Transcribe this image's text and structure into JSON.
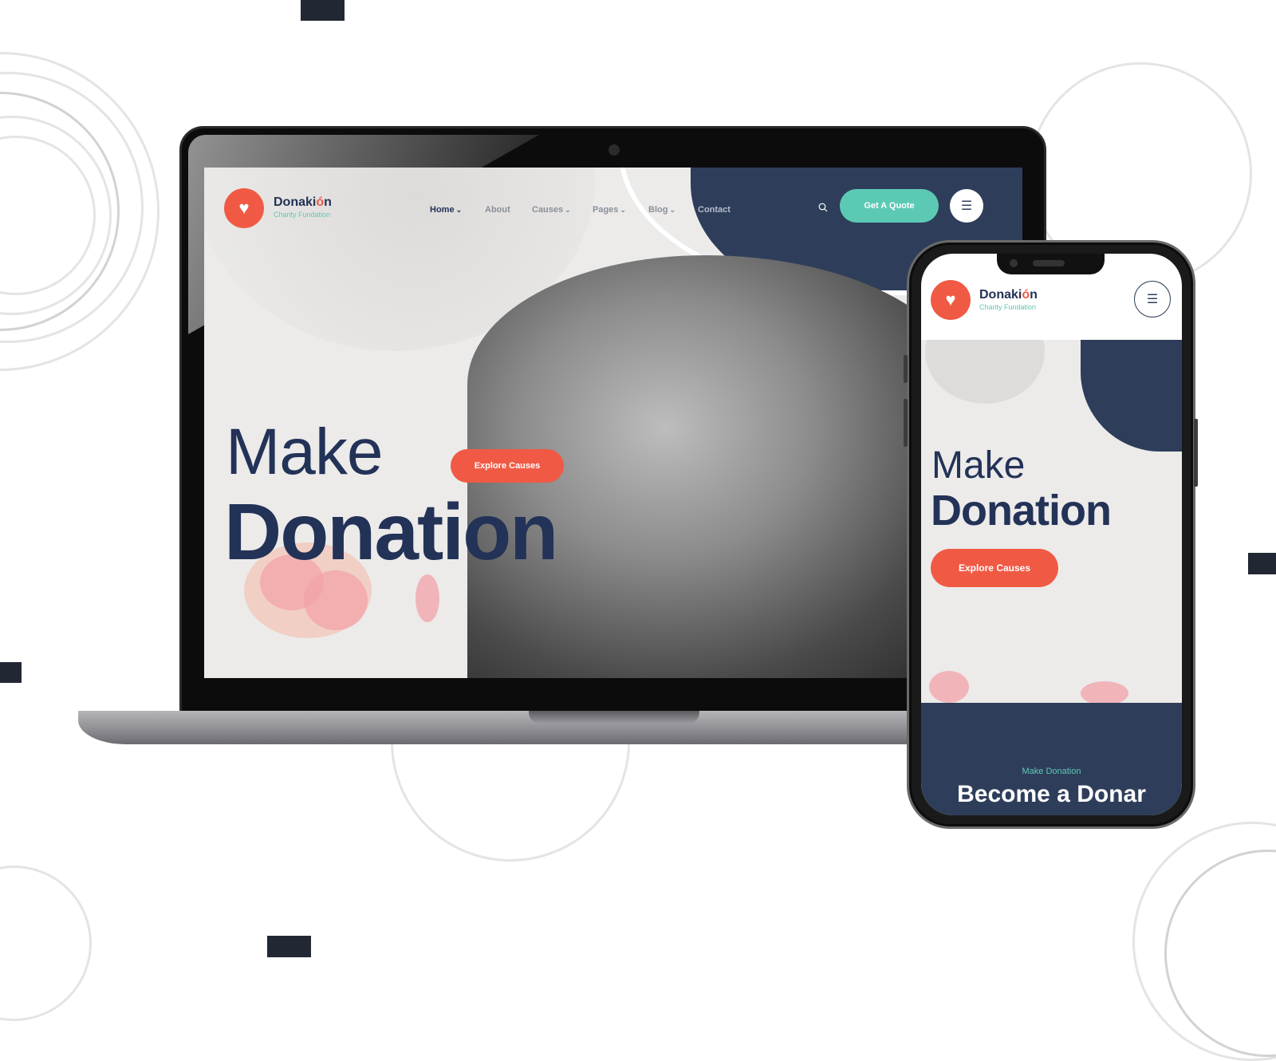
{
  "brand": {
    "name_main": "Donaki",
    "name_accent": "ó",
    "name_end": "n",
    "tagline": "Charity Fundation",
    "logo_icon": "heart-hands-icon"
  },
  "desktop": {
    "nav": [
      {
        "label": "Home",
        "has_dropdown": true,
        "active": true
      },
      {
        "label": "About",
        "has_dropdown": false
      },
      {
        "label": "Causes",
        "has_dropdown": true
      },
      {
        "label": "Pages",
        "has_dropdown": true
      },
      {
        "label": "Blog",
        "has_dropdown": true
      },
      {
        "label": "Contact",
        "has_dropdown": false
      }
    ],
    "search_icon": "search-icon",
    "quote_button": "Get A Quote",
    "menu_icon": "hamburger-icon",
    "hero_line1": "Make",
    "hero_line2": "Donation",
    "explore_button": "Explore Causes"
  },
  "mobile": {
    "hero_line1": "Make",
    "hero_line2": "Donation",
    "explore_button": "Explore Causes",
    "section_eyebrow": "Make Donation",
    "section_title": "Become a Donar"
  },
  "colors": {
    "primary": "#f05a45",
    "navy": "#2e3e5a",
    "teal": "#5cc9b5",
    "hero_bg": "#ecebea"
  },
  "glyphs": {
    "chevron": "⌄",
    "menu": "☰",
    "heart": "♥"
  }
}
